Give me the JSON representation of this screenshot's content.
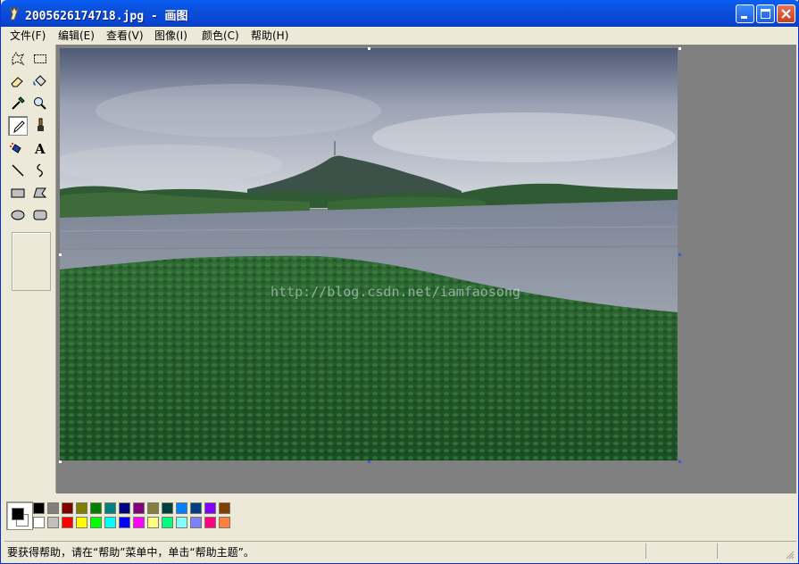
{
  "window": {
    "title": "2005626174718.jpg - 画图",
    "controls": [
      "minimize",
      "maximize",
      "close"
    ]
  },
  "menubar": {
    "items": [
      {
        "label": "文件(F)"
      },
      {
        "label": "编辑(E)"
      },
      {
        "label": "查看(V)"
      },
      {
        "label": "图像(I)"
      },
      {
        "label": "颜色(C)"
      },
      {
        "label": "帮助(H)"
      }
    ]
  },
  "toolbox": {
    "tools": [
      {
        "name": "free-select-icon"
      },
      {
        "name": "rect-select-icon"
      },
      {
        "name": "eraser-icon"
      },
      {
        "name": "fill-bucket-icon"
      },
      {
        "name": "color-picker-icon"
      },
      {
        "name": "magnifier-icon"
      },
      {
        "name": "pencil-icon",
        "active": true
      },
      {
        "name": "brush-icon"
      },
      {
        "name": "airbrush-icon"
      },
      {
        "name": "text-icon"
      },
      {
        "name": "line-icon"
      },
      {
        "name": "curve-icon"
      },
      {
        "name": "rectangle-icon"
      },
      {
        "name": "polygon-icon"
      },
      {
        "name": "ellipse-icon"
      },
      {
        "name": "rounded-rect-icon"
      }
    ]
  },
  "canvas": {
    "watermark": "http://blog.csdn.net/iamfaosong"
  },
  "palette": {
    "foreground": "#000000",
    "background": "#ffffff",
    "row1": [
      "#000000",
      "#808080",
      "#800000",
      "#808000",
      "#008000",
      "#008080",
      "#000080",
      "#800080",
      "#808040",
      "#004040",
      "#0080ff",
      "#004080",
      "#8000ff",
      "#804000"
    ],
    "row2": [
      "#ffffff",
      "#c0c0c0",
      "#ff0000",
      "#ffff00",
      "#00ff00",
      "#00ffff",
      "#0000ff",
      "#ff00ff",
      "#ffff80",
      "#00ff80",
      "#80ffff",
      "#8080ff",
      "#ff0080",
      "#ff8040"
    ]
  },
  "statusbar": {
    "text": "要获得帮助，请在“帮助”菜单中，单击“帮助主题”。"
  }
}
